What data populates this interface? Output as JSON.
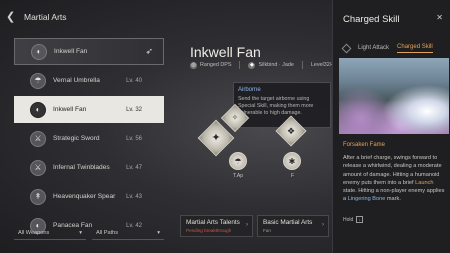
{
  "header": {
    "title": "Martial Arts"
  },
  "weapons": [
    {
      "name": "Inkwell Fan",
      "level": "",
      "state": "equipped",
      "icon": "fan-icon"
    },
    {
      "name": "Vernal Umbrella",
      "level": "Lv. 40",
      "state": "",
      "icon": "umbrella-icon"
    },
    {
      "name": "Inkwell Fan",
      "level": "Lv. 32",
      "state": "selected",
      "icon": "fan-icon"
    },
    {
      "name": "Strategic Sword",
      "level": "Lv. 56",
      "state": "",
      "icon": "sword-icon"
    },
    {
      "name": "Infernal Twinblades",
      "level": "Lv. 47",
      "state": "",
      "icon": "twinblades-icon"
    },
    {
      "name": "Heavenquaker Spear",
      "level": "Lv. 43",
      "state": "",
      "icon": "spear-icon"
    },
    {
      "name": "Panacea Fan",
      "level": "Lv. 42",
      "state": "",
      "icon": "fan-icon"
    }
  ],
  "filters": {
    "weapons": "All Weapons",
    "paths": "All Paths"
  },
  "weapon": {
    "name": "Inkwell Fan",
    "type": "Ranged DPS",
    "bind": "Silkbind · Jade",
    "level": "Level32/40"
  },
  "tooltip": {
    "title": "Airborne",
    "body": "Send the target airborne using Special Skill, making them more vulnerable to high damage."
  },
  "nodes": {
    "label_left": "T.Ap",
    "label_right": "F"
  },
  "bottom": {
    "talents_title": "Martial Arts Talents",
    "talents_status": "Pending breakthrough",
    "basic_title": "Basic Martial Arts",
    "basic_status": "Fan"
  },
  "panel": {
    "title": "Charged Skill",
    "tab1": "Light Attack",
    "tab2": "Charged Skill",
    "subtitle": "Forsaken Fame",
    "desc1": "After a brief charge, swings forward to release a whirlwind, dealing a moderate amount of damage.",
    "desc2_pre": "Hitting a humanoid enemy puts them into a brief",
    "desc2_hl": "Launch",
    "desc2_post": "state. Hitting a non-player enemy applies a",
    "desc3_hl": "Lingering Bone",
    "desc3_post": "mark.",
    "hold": "Hold"
  }
}
